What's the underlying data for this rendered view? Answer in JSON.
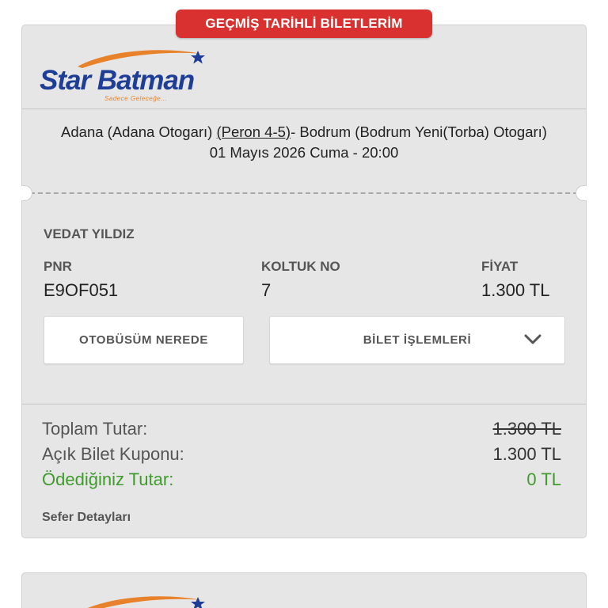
{
  "header": {
    "title": "GEÇMİŞ TARİHLİ BİLETLERİM"
  },
  "logo": {
    "brand": "Star Batman",
    "tagline": "Sadece Geleceğe...",
    "icons": [
      "swoosh-star-icon"
    ]
  },
  "route": {
    "origin": "Adana (Adana Otogarı)",
    "platform": "(Peron 4-5)",
    "destination": "- Bodrum (Bodrum Yeni(Torba) Otogarı)",
    "datetime": "01 Mayıs 2026 Cuma - 20:00"
  },
  "passenger": {
    "name": "VEDAT YILDIZ"
  },
  "fields": {
    "pnr_label": "PNR",
    "pnr_value": "E9OF051",
    "seat_label": "KOLTUK NO",
    "seat_value": "7",
    "price_label": "FİYAT",
    "price_value": "1.300 TL"
  },
  "buttons": {
    "bus_location": "OTOBÜSÜM NEREDE",
    "ticket_actions": "BİLET İŞLEMLERİ"
  },
  "summary": {
    "total_label": "Toplam Tutar:",
    "total_value": "1.300 TL",
    "coupon_label": "Açık Bilet Kuponu:",
    "coupon_value": "1.300 TL",
    "paid_label": "Ödediğiniz Tutar:",
    "paid_value": "0 TL"
  },
  "trip_details_label": "Sefer Detayları",
  "colors": {
    "accent_red": "#d9312f",
    "brand_blue": "#1d3d97",
    "brand_orange": "#e8822a",
    "paid_green": "#3f9b2b"
  }
}
